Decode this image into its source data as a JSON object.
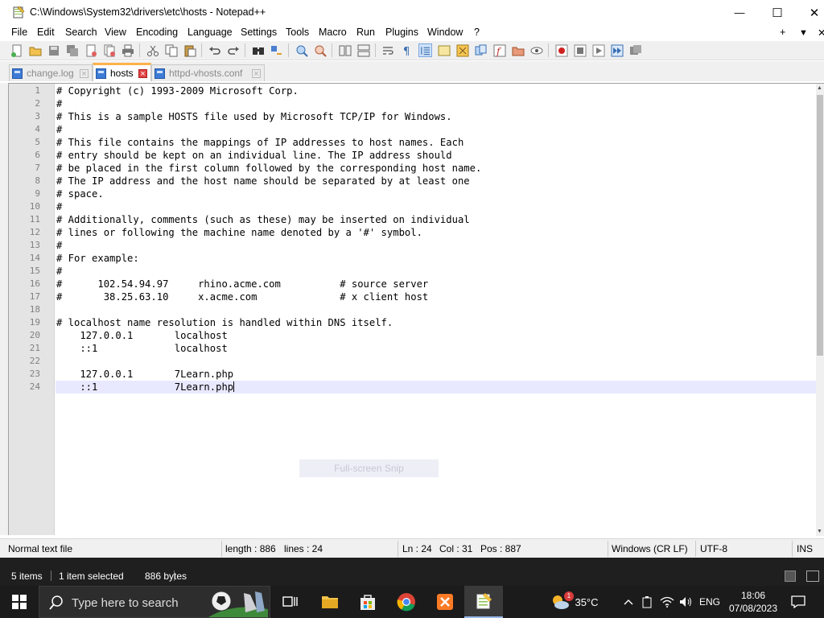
{
  "window": {
    "title": "C:\\Windows\\System32\\drivers\\etc\\hosts - Notepad++",
    "minimize": "—",
    "maximize": "☐",
    "close": "✕"
  },
  "menu": {
    "items": [
      "File",
      "Edit",
      "Search",
      "View",
      "Encoding",
      "Language",
      "Settings",
      "Tools",
      "Macro",
      "Run",
      "Plugins",
      "Window",
      "?"
    ],
    "right": [
      "+",
      "▼",
      "✕"
    ]
  },
  "tabs": [
    {
      "label": "change.log",
      "active": false
    },
    {
      "label": "hosts",
      "active": true
    },
    {
      "label": "httpd-vhosts.conf",
      "active": false
    }
  ],
  "editor": {
    "lines": [
      "# Copyright (c) 1993-2009 Microsoft Corp.",
      "#",
      "# This is a sample HOSTS file used by Microsoft TCP/IP for Windows.",
      "#",
      "# This file contains the mappings of IP addresses to host names. Each",
      "# entry should be kept on an individual line. The IP address should",
      "# be placed in the first column followed by the corresponding host name.",
      "# The IP address and the host name should be separated by at least one",
      "# space.",
      "#",
      "# Additionally, comments (such as these) may be inserted on individual",
      "# lines or following the machine name denoted by a '#' symbol.",
      "#",
      "# For example:",
      "#",
      "#      102.54.94.97     rhino.acme.com          # source server",
      "#       38.25.63.10     x.acme.com              # x client host",
      "",
      "# localhost name resolution is handled within DNS itself.",
      "    127.0.0.1       localhost",
      "    ::1             localhost",
      "",
      "    127.0.0.1       7Learn.php",
      "    ::1             7Learn.php"
    ],
    "current_line": 24
  },
  "status": {
    "file_type": "Normal text file",
    "length": "length : 886",
    "lines": "lines : 24",
    "ln": "Ln : 24",
    "col": "Col : 31",
    "pos": "Pos : 887",
    "eol": "Windows (CR LF)",
    "encoding": "UTF-8",
    "mode": "INS"
  },
  "explorer_status": {
    "items": "5 items",
    "selected": "1 item selected",
    "size": "886 bytes"
  },
  "overlay": {
    "snip_label": "Full-screen Snip"
  },
  "taskbar": {
    "search_placeholder": "Type here to search",
    "weather_temp": "35°C",
    "weather_badge": "1",
    "language": "ENG",
    "time": "18:06",
    "date": "07/08/2023"
  }
}
